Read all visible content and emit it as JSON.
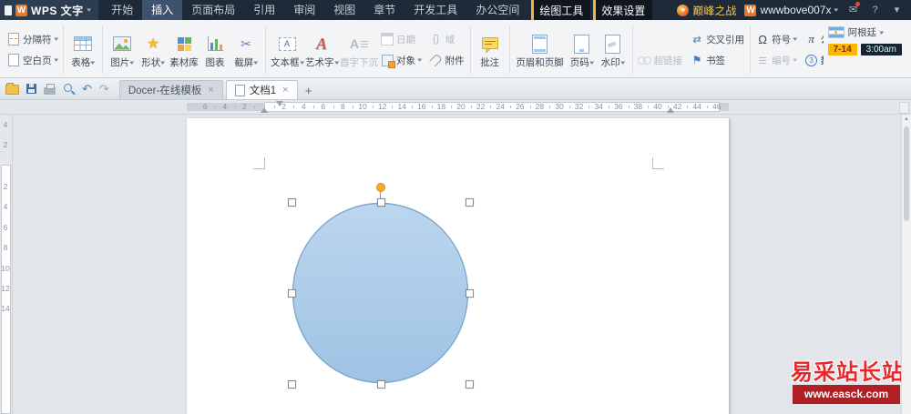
{
  "title_bar": {
    "logo_letter": "W",
    "app_name": "WPS 文字",
    "menu_tabs": [
      "开始",
      "插入",
      "页面布局",
      "引用",
      "审阅",
      "视图",
      "章节",
      "开发工具",
      "办公空间"
    ],
    "context_tabs": [
      "绘图工具",
      "效果设置"
    ],
    "game_label": "巅峰之战",
    "account_name": "wwwbove007x",
    "help_label": "?"
  },
  "ribbon": {
    "break_label": "分隔符",
    "blank_page_label": "空白页",
    "table_label": "表格",
    "picture_label": "图片",
    "shapes_label": "形状",
    "assets_label": "素材库",
    "chart_label": "图表",
    "screenshot_label": "截屏",
    "textbox_label": "文本框",
    "wordart_label": "艺术字",
    "dropcap_label": "首字下沉",
    "date_label": "日期",
    "field_label": "域",
    "object_label": "对象",
    "attachment_label": "附件",
    "comment_label": "批注",
    "header_footer_label": "页眉和页脚",
    "page_number_label": "页码",
    "watermark_label": "水印",
    "hyperlink_label": "超链接",
    "bookmark_label": "书签",
    "crossref_label": "交叉引用",
    "symbol_label": "符号",
    "symbol_glyph": "Ω",
    "formula_label": "公式",
    "formula_glyph": "π",
    "numbering_label": "编号",
    "number_label": "数字",
    "number_glyph": "3",
    "worldcup": {
      "team": "阿根廷",
      "score": "7-14",
      "time": "3:00am"
    }
  },
  "tab_bar": {
    "tabs": [
      {
        "label": "Docer-在线模板",
        "close": "×"
      },
      {
        "label": "文档1",
        "close": "×"
      }
    ],
    "new_tab_label": "+"
  },
  "ruler": {
    "h_left_numbers": [
      "6",
      "4",
      "2"
    ],
    "h_main_numbers": [
      "2",
      "4",
      "6",
      "8",
      "10",
      "12",
      "14",
      "16",
      "18",
      "20",
      "22",
      "24",
      "26",
      "28",
      "30",
      "32",
      "34",
      "36",
      "38",
      "40",
      "42",
      "44",
      "46"
    ],
    "v_top_numbers": [
      "4",
      "2"
    ],
    "v_main_numbers": [
      "2",
      "4",
      "6",
      "8",
      "10",
      "12",
      "14"
    ]
  },
  "shape": {
    "type": "ellipse",
    "fill_top": "#bcd6ee",
    "fill_bottom": "#9fc3e4",
    "stroke": "#7ea8cc",
    "rotate_handle_color": "#ffa826"
  },
  "watermark": {
    "line1": "易采站长站",
    "line2": "www.easck.com",
    "color": "#e8272c"
  }
}
